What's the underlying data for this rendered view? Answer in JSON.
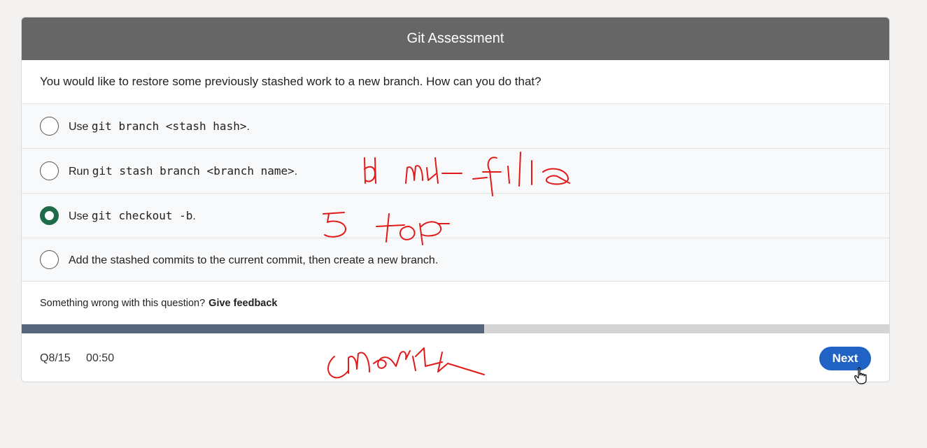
{
  "header": {
    "title": "Git Assessment"
  },
  "question": {
    "text": "You would like to restore some previously stashed work to a new branch. How can you do that?"
  },
  "options": [
    {
      "prefix": "Use ",
      "code": "git branch <stash hash>",
      "suffix": ".",
      "selected": false
    },
    {
      "prefix": "Run ",
      "code": "git stash branch <branch name>",
      "suffix": ".",
      "selected": false
    },
    {
      "prefix": "Use ",
      "code": "git checkout -b",
      "suffix": ".",
      "selected": true
    },
    {
      "prefix": "Add the stashed commits to the current commit, then create a new branch.",
      "code": "",
      "suffix": "",
      "selected": false
    }
  ],
  "feedback": {
    "text": "Something wrong with this question?",
    "link": "Give feedback"
  },
  "progress": {
    "fraction": 0.533
  },
  "footer": {
    "question_counter": "Q8/15",
    "timer": "00:50",
    "next_label": "Next"
  },
  "colors": {
    "header_bg": "#666666",
    "selected_radio": "#1e6b4a",
    "progress_fill": "#56657a",
    "next_button": "#2063c4",
    "annotation_ink": "#e11a1a"
  }
}
